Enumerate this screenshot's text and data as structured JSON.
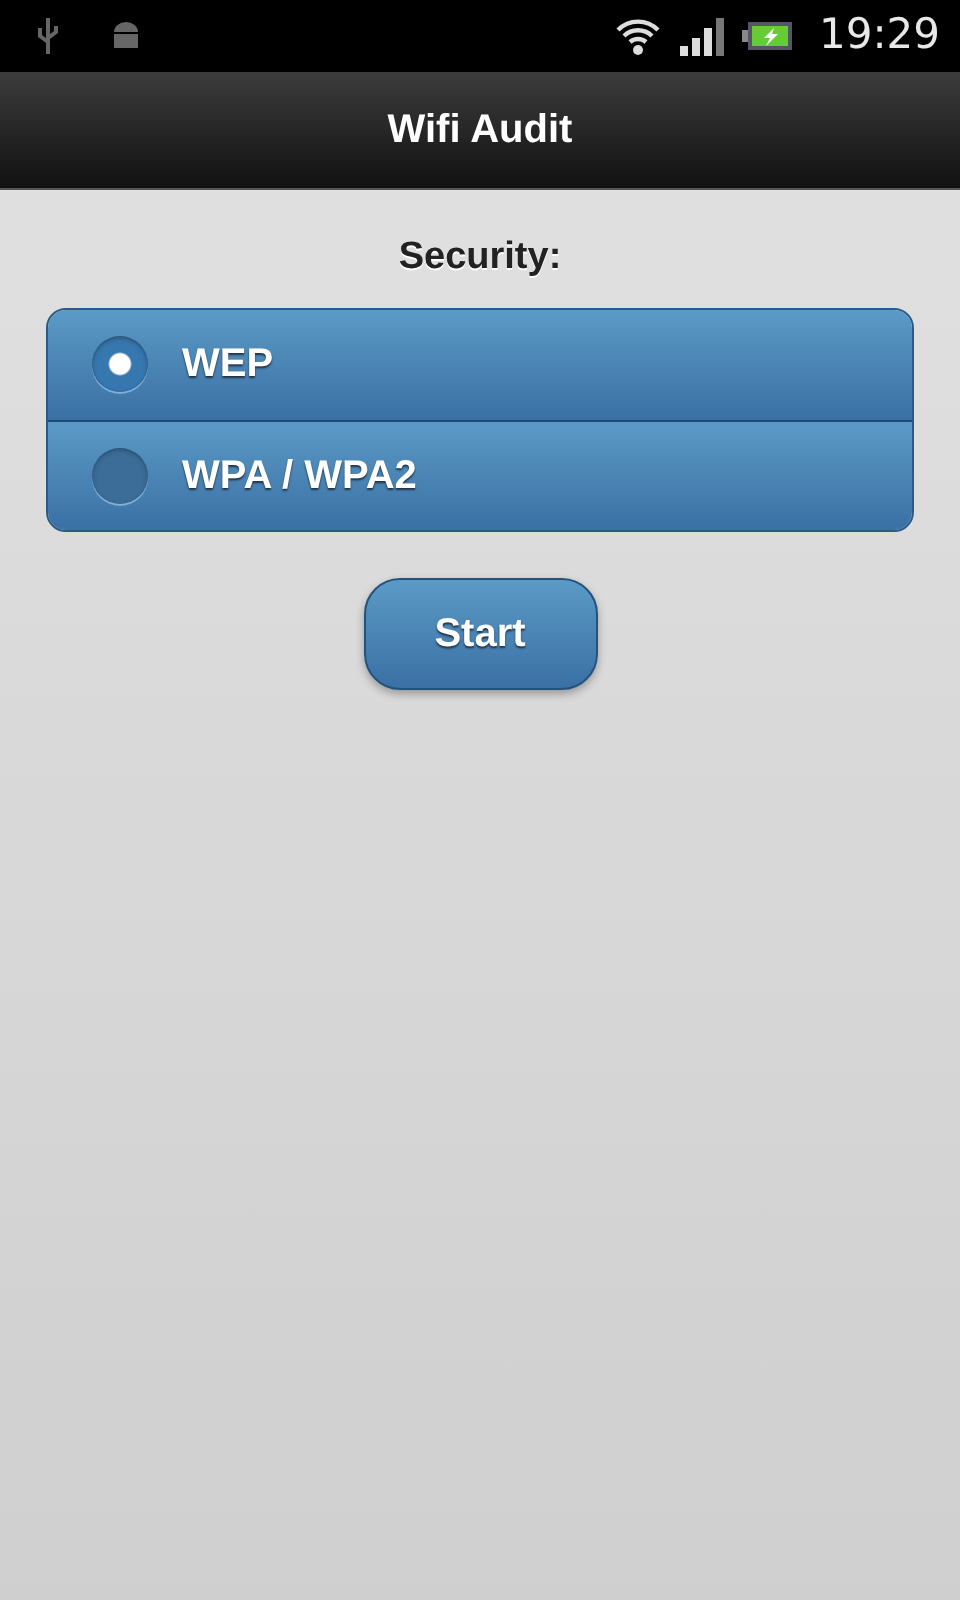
{
  "status_bar": {
    "time": "19:29"
  },
  "header": {
    "title": "Wifi Audit"
  },
  "security": {
    "label": "Security:",
    "options": [
      {
        "label": "WEP",
        "selected": true
      },
      {
        "label": "WPA / WPA2",
        "selected": false
      }
    ]
  },
  "buttons": [
    "Start"
  ]
}
